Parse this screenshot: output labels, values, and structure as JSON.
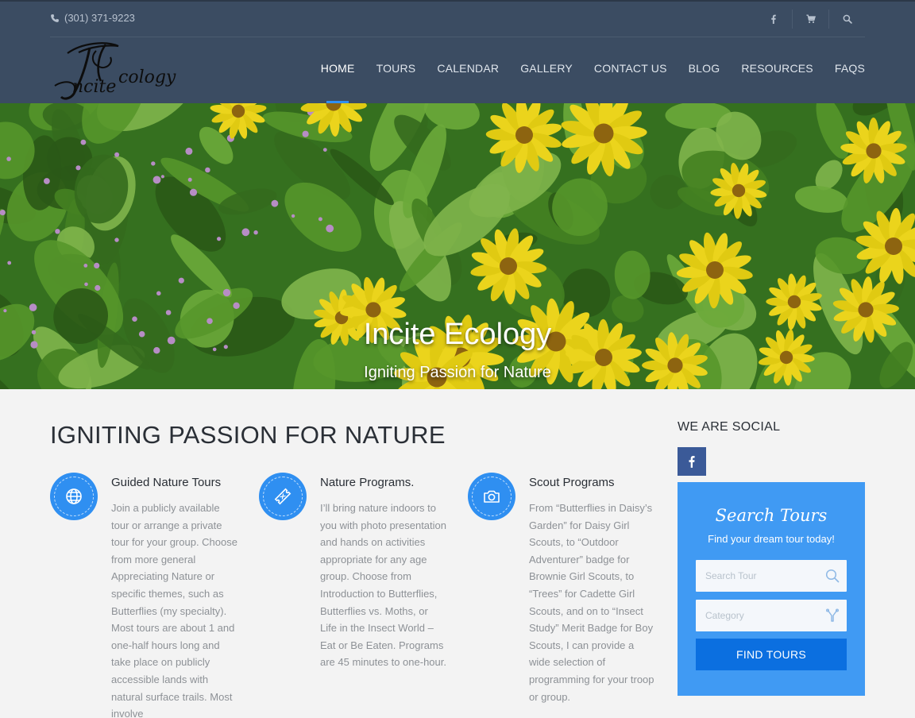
{
  "topbar": {
    "phone": "(301) 371-9223",
    "icons": [
      "facebook-icon",
      "cart-icon",
      "search-icon"
    ]
  },
  "logo": {
    "text": "Incite Ecology",
    "letters": {
      "first": "I",
      "second": "E",
      "rest1": "ncite",
      "rest2": "cology"
    }
  },
  "nav": {
    "items": [
      {
        "label": "HOME",
        "active": true
      },
      {
        "label": "TOURS"
      },
      {
        "label": "CALENDAR"
      },
      {
        "label": "GALLERY"
      },
      {
        "label": "CONTACT US"
      },
      {
        "label": "BLOG"
      },
      {
        "label": "RESOURCES"
      },
      {
        "label": "FAQS"
      }
    ]
  },
  "hero": {
    "title": "Incite Ecology",
    "subtitle": "Igniting Passion for Nature"
  },
  "main": {
    "title": "IGNITING PASSION FOR NATURE",
    "features": [
      {
        "icon": "globe-icon",
        "title": "Guided Nature Tours",
        "description": "Join a publicly available tour or arrange a private tour for your group. Choose from more general Appreciating Nature or specific themes, such as Butterflies (my specialty). Most tours are about 1 and one-half hours long and take place on publicly accessible lands with natural surface trails. Most involve"
      },
      {
        "icon": "ticket-icon",
        "title": "Nature Programs.",
        "description": "I’ll bring nature indoors to you with photo presentation and hands on activities appropriate for any age group. Choose from Introduction to Butterflies, Butterflies vs. Moths, or Life in the Insect World – Eat or Be Eaten. Programs are 45 minutes to one-hour."
      },
      {
        "icon": "camera-icon",
        "title": "Scout Programs",
        "description": "From “Butterflies in Daisy’s Garden” for Daisy Girl Scouts, to “Outdoor Adventurer” badge for Brownie Girl Scouts, to “Trees” for Cadette Girl Scouts, and on to “Insect Study” Merit Badge for Boy Scouts, I can provide a wide selection of programming for your troop or group."
      }
    ]
  },
  "sidebar": {
    "social_title": "WE ARE SOCIAL",
    "social_icon": "facebook-icon",
    "search": {
      "title": "Search Tours",
      "subtitle": "Find your dream tour today!",
      "search_placeholder": "Search Tour",
      "category_placeholder": "Category",
      "button_label": "FIND TOURS"
    }
  },
  "colors": {
    "header_bg": "#3b4c62",
    "accent": "#2f8ff1",
    "search_panel": "#409af3",
    "find_button": "#0b6fe0",
    "facebook": "#3b5a98"
  }
}
